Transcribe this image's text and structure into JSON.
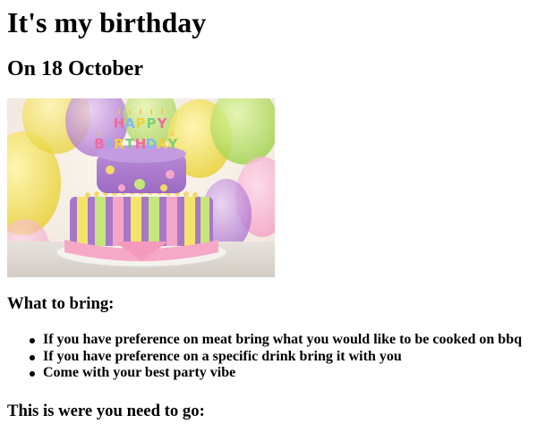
{
  "page": {
    "title": "It's my birthday",
    "subtitle": "On 18 October"
  },
  "image": {
    "icon": "birthday-cake-image",
    "cake_topper_text": "HAPPY BIRTHDAY"
  },
  "bring": {
    "heading": "What to bring:",
    "items": [
      "If you have preference on meat bring what you would like to be cooked on bbq",
      "If you have preference on a specific drink bring it with you",
      "Come with your best party vibe"
    ]
  },
  "directions": {
    "heading": "This is were you need to go:"
  },
  "colors": {
    "text": "#000000",
    "background": "#ffffff"
  }
}
